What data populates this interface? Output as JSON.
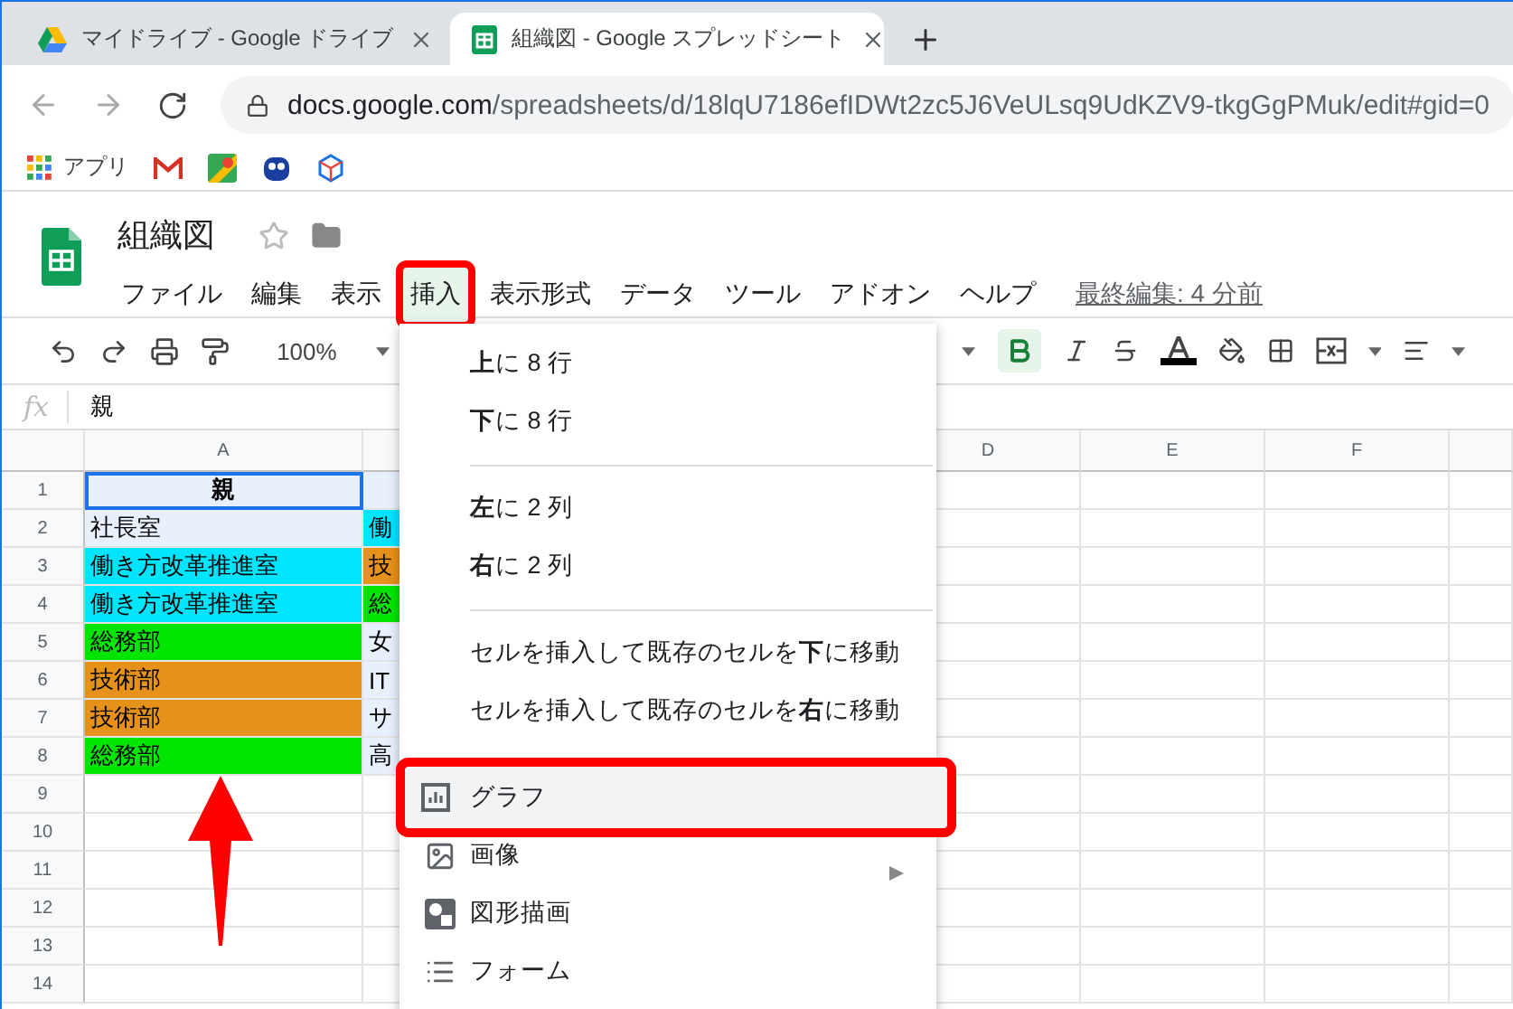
{
  "browser": {
    "tabs": [
      {
        "title": "マイドライブ - Google ドライブ",
        "kind": "drive",
        "selected": false
      },
      {
        "title": "組織図 - Google スプレッドシート",
        "kind": "sheets",
        "selected": true
      }
    ],
    "url": {
      "host": "docs.google.com",
      "path": "/spreadsheets/d/18lqU7186efIDWt2zc5J6VeULsq9UdKZV9-tkgGgPMuk/edit#gid=0"
    },
    "bookmarks": [
      {
        "kind": "apps",
        "label": "アプリ"
      },
      {
        "kind": "gmail"
      },
      {
        "kind": "maps"
      },
      {
        "kind": "robot"
      },
      {
        "kind": "cube"
      }
    ]
  },
  "doc": {
    "title": "組織図",
    "menu": [
      {
        "label": "ファイル",
        "selected": false,
        "marked": false
      },
      {
        "label": "編集",
        "selected": false,
        "marked": false
      },
      {
        "label": "表示",
        "selected": false,
        "marked": false
      },
      {
        "label": "挿入",
        "selected": true,
        "marked": true
      },
      {
        "label": "表示形式",
        "selected": false,
        "marked": false
      },
      {
        "label": "データ",
        "selected": false,
        "marked": false
      },
      {
        "label": "ツール",
        "selected": false,
        "marked": false
      },
      {
        "label": "アドオン",
        "selected": false,
        "marked": false
      },
      {
        "label": "ヘルプ",
        "selected": false,
        "marked": false
      }
    ],
    "last_edit": "最終編集: 4 分前"
  },
  "toolbar": {
    "zoom": "100%",
    "bold_active": true
  },
  "formula_bar": {
    "label": "fx",
    "value": "親"
  },
  "sheet": {
    "columns": [
      {
        "kind": "label",
        "label": "A"
      },
      {
        "kind": "covered"
      },
      {
        "kind": "covered"
      },
      {
        "kind": "label",
        "label": "D"
      },
      {
        "kind": "label",
        "label": "E"
      },
      {
        "kind": "label",
        "label": "F"
      }
    ],
    "rows": [
      {
        "number": "1",
        "cells": [
          {
            "text": "親",
            "color": "#e8f0fe",
            "selected": true
          },
          {
            "color": "#e8f0fe",
            "selected": false
          }
        ]
      },
      {
        "number": "2",
        "cells": [
          {
            "text": "社長室",
            "color": "#e8f0fe",
            "selected": false
          },
          {
            "text": "働",
            "color": "#00e5ff",
            "selected": false
          }
        ]
      },
      {
        "number": "3",
        "cells": [
          {
            "text": "働き方改革推進室",
            "color": "#00e5ff",
            "selected": false
          },
          {
            "text": "技",
            "color": "#e69119",
            "selected": false
          }
        ]
      },
      {
        "number": "4",
        "cells": [
          {
            "text": "働き方改革推進室",
            "color": "#00e5ff",
            "selected": false
          },
          {
            "text": "総",
            "color": "#00e600",
            "selected": false
          }
        ]
      },
      {
        "number": "5",
        "cells": [
          {
            "text": "総務部",
            "color": "#00e600",
            "selected": false
          },
          {
            "text": "女",
            "color": "#e8f0fe",
            "selected": false
          }
        ]
      },
      {
        "number": "6",
        "cells": [
          {
            "text": "技術部",
            "color": "#e69119",
            "selected": false
          },
          {
            "text": "IT",
            "color": "#e8f0fe",
            "selected": false
          }
        ]
      },
      {
        "number": "7",
        "cells": [
          {
            "text": "技術部",
            "color": "#e69119",
            "selected": false
          },
          {
            "text": "サ",
            "color": "#e8f0fe",
            "selected": false
          }
        ]
      },
      {
        "number": "8",
        "cells": [
          {
            "text": "総務部",
            "color": "#00e600",
            "selected": false
          },
          {
            "text": "高",
            "color": "#e8f0fe",
            "selected": false
          }
        ]
      },
      {
        "number": "9",
        "cells": []
      },
      {
        "number": "10",
        "cells": []
      },
      {
        "number": "11",
        "cells": []
      },
      {
        "number": "12",
        "cells": []
      },
      {
        "number": "13",
        "cells": []
      },
      {
        "number": "14",
        "cells": []
      }
    ]
  },
  "insert_menu": [
    {
      "kind": "item",
      "label": "**上**に 8 行"
    },
    {
      "kind": "item",
      "label": "**下**に 8 行"
    },
    {
      "kind": "separator"
    },
    {
      "kind": "item",
      "label": "**左**に 2 列"
    },
    {
      "kind": "item",
      "label": "**右**に 2 列"
    },
    {
      "kind": "separator"
    },
    {
      "kind": "item",
      "label": "セルを挿入して既存のセルを**下**に移動"
    },
    {
      "kind": "item",
      "label": "セルを挿入して既存のセルを**右**に移動"
    },
    {
      "kind": "chart",
      "label": "グラフ",
      "highlighted": true,
      "marked": true
    },
    {
      "kind": "image",
      "label": "画像",
      "submenu": true
    },
    {
      "kind": "shape",
      "label": "図形描画"
    },
    {
      "kind": "form",
      "label": "フォーム"
    }
  ],
  "annotations": [
    {
      "kind": "arrow"
    }
  ]
}
